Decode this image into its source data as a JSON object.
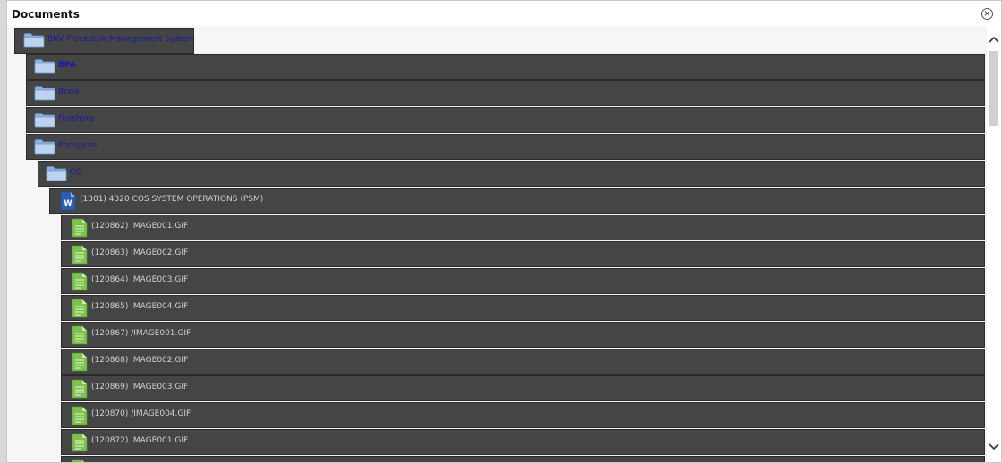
{
  "dialog": {
    "title": "Documents",
    "close_label": "×"
  },
  "tree": {
    "root": {
      "label": "BKV Procedure Management System",
      "icon": "folder-icon"
    },
    "folders": [
      {
        "label": "BPA",
        "icon": "folder-icon"
      },
      {
        "label": "Brine",
        "icon": "folder-icon"
      },
      {
        "label": "Finishing",
        "icon": "folder-icon"
      },
      {
        "label": "Phosgene",
        "icon": "folder-icon"
      }
    ],
    "subfolder": {
      "label": "CO",
      "icon": "folder-icon"
    },
    "document": {
      "label": "(1301) 4320 COS SYSTEM OPERATIONS (PSM)",
      "icon": "word-document-icon"
    },
    "attachments": [
      {
        "label": "(120862) IMAGE001.GIF",
        "icon": "image-file-icon"
      },
      {
        "label": "(120863) IMAGE002.GIF",
        "icon": "image-file-icon"
      },
      {
        "label": "(120864) IMAGE003.GIF",
        "icon": "image-file-icon"
      },
      {
        "label": "(120865) IMAGE004.GIF",
        "icon": "image-file-icon"
      },
      {
        "label": "(120867) /IMAGE001.GIF",
        "icon": "image-file-icon"
      },
      {
        "label": "(120868) IMAGE002.GIF",
        "icon": "image-file-icon"
      },
      {
        "label": "(120869) IMAGE003.GIF",
        "icon": "image-file-icon"
      },
      {
        "label": "(120870) /IMAGE004.GIF",
        "icon": "image-file-icon"
      },
      {
        "label": "(120872) IMAGE001.GIF",
        "icon": "image-file-icon"
      }
    ]
  },
  "scrollbar": {
    "up_icon": "chevron-up-icon",
    "down_icon": "chevron-down-icon"
  },
  "colors": {
    "row_background": "#454545",
    "link_text": "#1a1aa8",
    "document_text": "#d0d0d0",
    "folder_fill": "#a7c4e8"
  }
}
